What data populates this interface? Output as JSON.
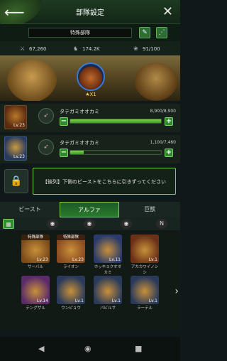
{
  "header": {
    "title": "部隊設定"
  },
  "squad": {
    "name": "特殊部隊"
  },
  "stats": {
    "power": "67,260",
    "beast_power": "174.2K",
    "capacity": "91/100"
  },
  "leader": {
    "rank": "★X1"
  },
  "beasts": [
    {
      "name": "タテガミオオカミ",
      "level": "Lv.23",
      "value": "8,900/8,900",
      "fill": 1.0
    },
    {
      "name": "タテガミオオカミ",
      "level": "Lv.23",
      "value": "1,100/7,460",
      "fill": 0.147
    }
  ],
  "hint": "【後列】下側のビーストをこちらに引きずってください",
  "tabs": [
    "ビースト",
    "アルファ",
    "巨獣"
  ],
  "cards": [
    {
      "badge": "特殊部隊",
      "level": "Lv.23",
      "name": "サーバル",
      "color": "#7a4a1a"
    },
    {
      "badge": "特殊部隊",
      "level": "Lv.23",
      "name": "ライオン",
      "color": "#8a4a20"
    },
    {
      "badge": "",
      "level": "Lv.11",
      "name": "ホッキョクオオカミ",
      "color": "#2a3a6a"
    },
    {
      "badge": "",
      "level": "Lv.1",
      "name": "アカカワイノシシ",
      "color": "#6a3018"
    },
    {
      "badge": "",
      "level": "Lv.14",
      "name": "テングザル",
      "color": "#5a2a6a"
    },
    {
      "badge": "",
      "level": "Lv.1",
      "name": "ウンピョウ",
      "color": "#2a3a5a"
    },
    {
      "badge": "",
      "level": "Lv.1",
      "name": "バビルサ",
      "color": "#2a3a5a"
    },
    {
      "badge": "",
      "level": "Lv.1",
      "name": "ラーテル",
      "color": "#2a3a5a"
    }
  ]
}
